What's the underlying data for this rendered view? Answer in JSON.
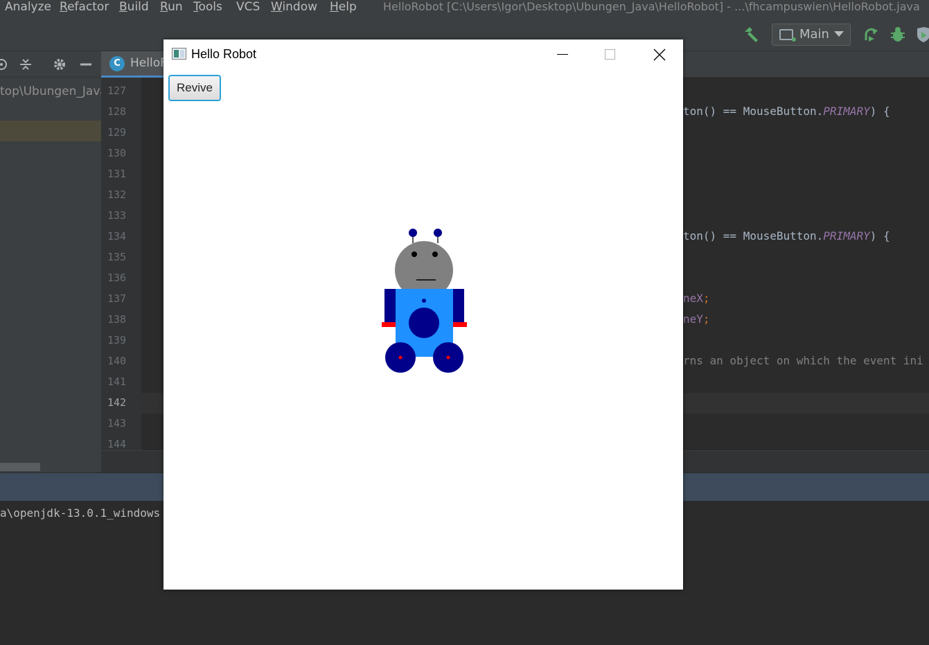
{
  "ide": {
    "menu": [
      "Analyze",
      "Refactor",
      "Build",
      "Run",
      "Tools",
      "VCS",
      "Window",
      "Help"
    ],
    "title": "HelloRobot [C:\\Users\\Igor\\Desktop\\Ubungen_Java\\HelloRobot] - ...\\fhcampuswien\\HelloRobot.java",
    "run_config": "Main",
    "project_path": "top\\Ubungen_Java",
    "tab_label": "HelloF",
    "tab_icon": "C",
    "line_numbers": [
      "127",
      "128",
      "129",
      "130",
      "131",
      "132",
      "133",
      "134",
      "135",
      "136",
      "137",
      "138",
      "139",
      "140",
      "141",
      "142",
      "143",
      "144"
    ],
    "current_line": "142",
    "code": {
      "l128_a": "ton() == MouseButton.",
      "l128_b": "PRIMARY",
      "l128_c": ") {",
      "l134_a": "ton() == MouseButton.",
      "l134_b": "PRIMARY",
      "l134_c": ") {",
      "l137_a": "neX",
      "l137_b": ";",
      "l138_a": "neY",
      "l138_b": ";",
      "l140": "rns an object on which the event ini"
    },
    "run_output": "a\\openjdk-13.0.1_windows"
  },
  "window": {
    "title": "Hello Robot",
    "revive_label": "Revive"
  },
  "colors": {
    "head": "#808080",
    "body": "#1e90ff",
    "dark_blue": "#00008b",
    "hands": "#ff0000",
    "wheel_hub": "#ff0000"
  }
}
